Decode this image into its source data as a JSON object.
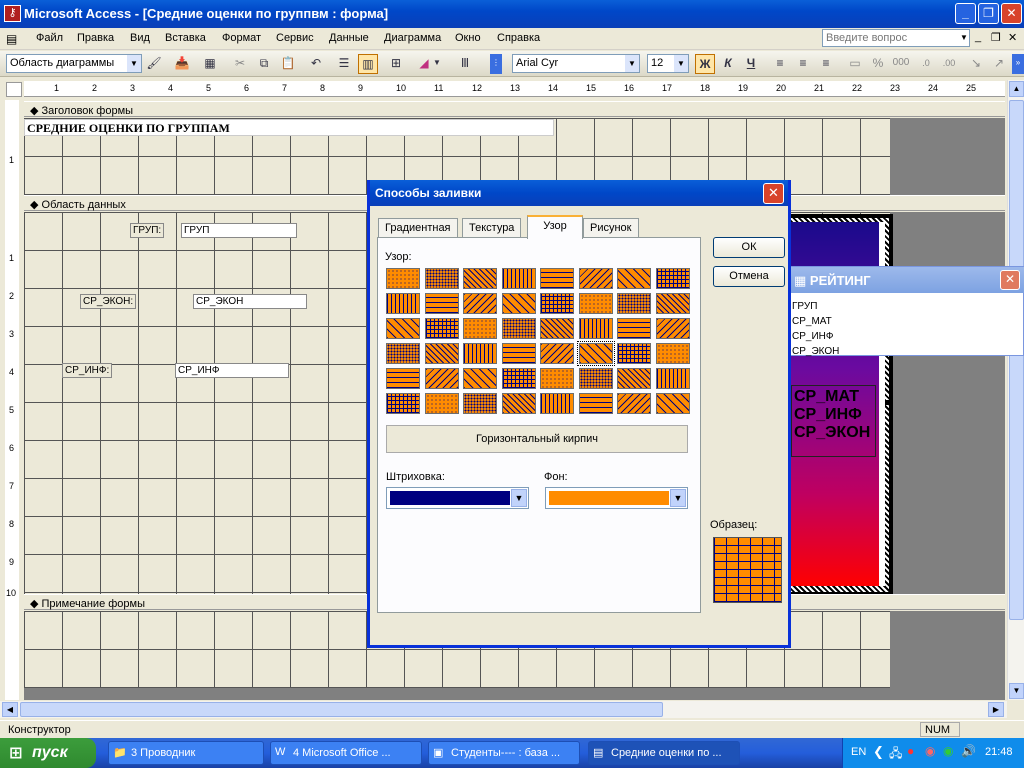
{
  "window": {
    "title": "Microsoft Access - [Средние оценки по группвм : форма]"
  },
  "menu": [
    "Файл",
    "Правка",
    "Вид",
    "Вставка",
    "Формат",
    "Сервис",
    "Данные",
    "Диаграмма",
    "Окно",
    "Справка"
  ],
  "ask_placeholder": "Введите вопрос",
  "toolbar": {
    "object_combo": "Область диаграммы",
    "font_combo": "Arial Cyr",
    "size_combo": "12",
    "bold": "Ж",
    "italic": "К",
    "underline": "Ч"
  },
  "ruler": [
    "1",
    "2",
    "3",
    "4",
    "5",
    "6",
    "7",
    "8",
    "9",
    "10",
    "11",
    "12",
    "13",
    "14",
    "15",
    "16",
    "17",
    "18",
    "19",
    "20",
    "21",
    "22",
    "23",
    "24",
    "25"
  ],
  "sections": {
    "header": "Заголовок формы",
    "detail": "Область данных",
    "footer": "Примечание формы"
  },
  "form_title": "СРЕДНИЕ  ОЦЕНКИ ПО ГРУППАМ",
  "fields": [
    {
      "label": "ГРУП:",
      "value": "ГРУП"
    },
    {
      "label": "СР_ЭКОН:",
      "value": "СР_ЭКОН"
    },
    {
      "label": "СР_ИНФ:",
      "value": "СР_ИНФ"
    }
  ],
  "dialog": {
    "title": "Способы заливки",
    "tabs": [
      "Градиентная",
      "Текстура",
      "Узор",
      "Рисунок"
    ],
    "active_tab": "Узор",
    "pattern_label": "Узор:",
    "selected_pattern_name": "Горизонтальный кирпич",
    "foreground_label": "Штриховка:",
    "background_label": "Фон:",
    "sample_label": "Образец:",
    "ok": "ОК",
    "cancel": "Отмена",
    "colors": {
      "foreground": "#000080",
      "background": "#ff8c00"
    }
  },
  "rating": {
    "title": "РЕЙТИНГ",
    "items": [
      "ГРУП",
      "СР_МАТ",
      "СР_ИНФ",
      "СР_ЭКОН"
    ]
  },
  "chart_labels": [
    "СР_МАТ",
    "СР_ИНФ",
    "СР_ЭКОН"
  ],
  "status": {
    "mode": "Конструктор",
    "num": "NUM"
  },
  "taskbar": {
    "start": "пуск",
    "tasks": [
      "3 Проводник",
      "4 Microsoft Office ...",
      "Студенты---- : база ...",
      "Средние оценки по ..."
    ],
    "lang": "EN",
    "clock": "21:48"
  }
}
